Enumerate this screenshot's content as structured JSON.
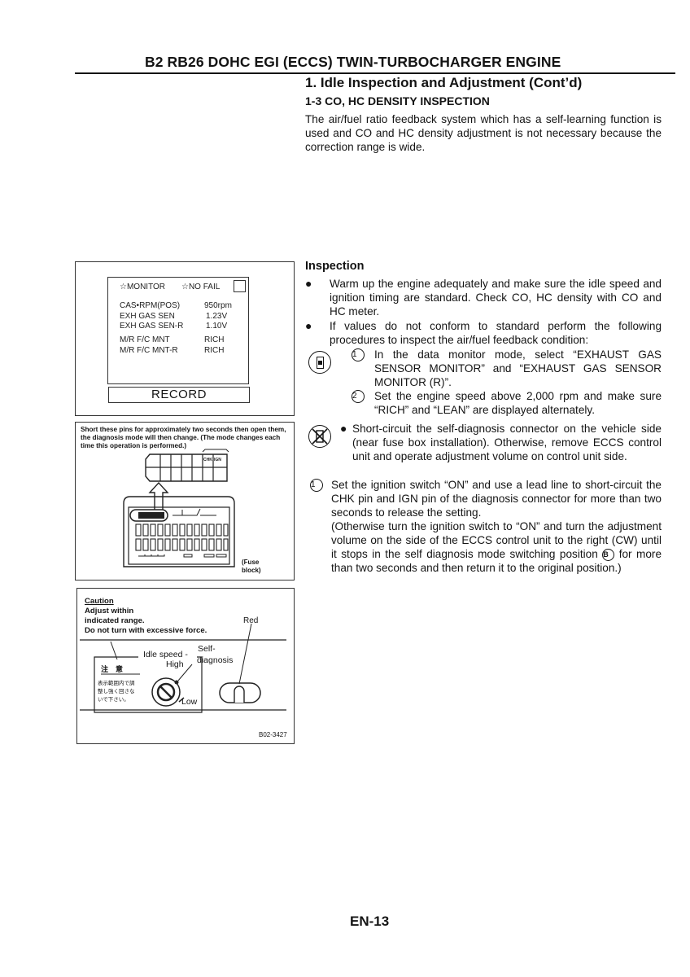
{
  "header": {
    "title": "B2  RB26 DOHC EGI (ECCS) TWIN-TURBOCHARGER ENGINE"
  },
  "section": {
    "title": "1.  Idle Inspection and Adjustment (Cont’d)",
    "subtitle": "1-3  CO, HC DENSITY INSPECTION",
    "intro": "The air/fuel ratio feedback system which has a self-learning function is used and CO and HC density adjustment is not necessary because the correction range is wide."
  },
  "inspection": {
    "heading": "Inspection",
    "bullets": [
      "Warm up the engine adequately and make sure the idle speed and ignition timing are standard. Check CO, HC density with CO and HC meter.",
      "If values do not conform to standard perform the following procedures to inspect the air/fuel feedback condition:"
    ],
    "consult_steps": [
      {
        "num": "1",
        "text": "In the data monitor mode, select “EXHAUST GAS SENSOR MONITOR” and “EXHAUST GAS SENSOR MONITOR (R)”."
      },
      {
        "num": "2",
        "text": "Set the engine speed above 2,000 rpm and make sure “RICH” and “LEAN” are displayed alternately."
      }
    ],
    "no_tool_bullet": "Short-circuit the self-diagnosis connector on the vehicle side (near fuse box installation). Otherwise, remove ECCS control unit and operate adjustment volume on control unit side.",
    "step1": {
      "num": "1",
      "text_a": "Set the ignition switch “ON” and use a lead line to short-circuit the CHK pin and IGN pin of the diagnosis connector for more than two seconds to release the setting.",
      "text_b_pre": "(Otherwise turn the ignition switch to “ON” and turn the adjustment volume on the side of the ECCS control unit to the right (CW) until it stops in the self diagnosis mode switching position ",
      "position_mark": "B",
      "text_b_post": " for more than two seconds and then return it to the original position.)"
    }
  },
  "monitor_figure": {
    "header_left": "☆MONITOR",
    "header_right": "☆NO FAIL",
    "rows": [
      {
        "label": "CAS•RPM(POS)",
        "value": "950rpm"
      },
      {
        "label": "EXH GAS SEN",
        "value": "1.23V"
      },
      {
        "label": "EXH GAS SEN-R",
        "value": "1.10V"
      },
      {
        "label": "M/R F/C MNT",
        "value": "RICH"
      },
      {
        "label": "M/R F/C MNT-R",
        "value": "RICH"
      }
    ],
    "record_label": "RECORD"
  },
  "connector_figure": {
    "note": "Short these pins for approximately two seconds then open them, the diagnosis mode will then change. (The mode changes each time this operation is performed.)",
    "pin_chk": "CHK",
    "pin_ign": "IGN",
    "fuse_label_1": "(Fuse",
    "fuse_label_2": "block)"
  },
  "adjust_figure": {
    "caution_title": "Caution",
    "caution_lines": [
      "Adjust within",
      "indicated range.",
      "Do not turn with excessive force."
    ],
    "red_label": "Red",
    "idle_speed": "Idle speed -",
    "high": "High",
    "self": "Self-",
    "diagnosis": "diagnosis",
    "low": "Low",
    "jp_title": "注　意",
    "jp_lines": [
      "表示範囲内で調",
      "整し強く回さな",
      "いで下さい。"
    ],
    "figure_id": "B02-3427"
  },
  "footer": {
    "page_number": "EN-13"
  }
}
